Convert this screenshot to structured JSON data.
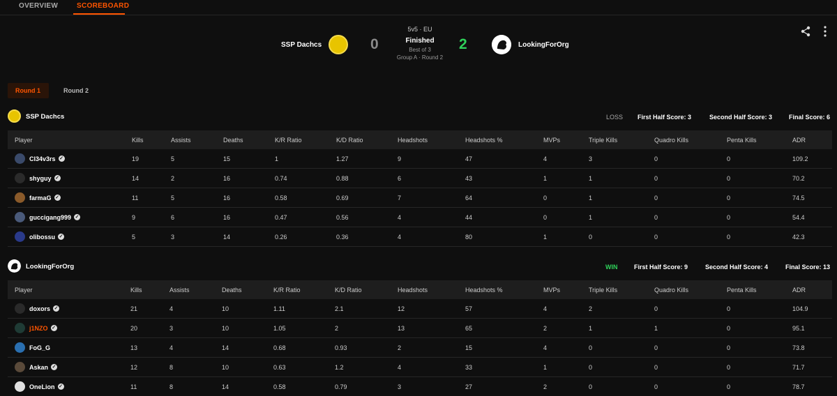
{
  "nav": {
    "tabs": [
      {
        "label": "OVERVIEW"
      },
      {
        "label": "SCOREBOARD"
      }
    ]
  },
  "match": {
    "team1": {
      "name": "SSP Dachcs",
      "score": "0"
    },
    "team2": {
      "name": "LookingForOrg",
      "score": "2"
    },
    "format": "5v5 · EU",
    "status": "Finished",
    "best_of": "Best of 3",
    "stage": "Group A · Round 2"
  },
  "rounds": [
    {
      "label": "Round 1"
    },
    {
      "label": "Round 2"
    }
  ],
  "columns": [
    "Player",
    "Kills",
    "Assists",
    "Deaths",
    "K/R Ratio",
    "K/D Ratio",
    "Headshots",
    "Headshots %",
    "MVPs",
    "Triple Kills",
    "Quadro Kills",
    "Penta Kills",
    "ADR"
  ],
  "teams": [
    {
      "name": "SSP Dachcs",
      "result": "LOSS",
      "first_half": "First Half Score: 3",
      "second_half": "Second Half Score: 3",
      "final": "Final Score: 6",
      "players": [
        {
          "name": "Cl34v3rs",
          "stats": [
            "19",
            "5",
            "15",
            "1",
            "1.27",
            "9",
            "47",
            "4",
            "3",
            "0",
            "0",
            "109.2"
          ]
        },
        {
          "name": "shyguy",
          "stats": [
            "14",
            "2",
            "16",
            "0.74",
            "0.88",
            "6",
            "43",
            "1",
            "1",
            "0",
            "0",
            "70.2"
          ]
        },
        {
          "name": "farmaG",
          "stats": [
            "11",
            "5",
            "16",
            "0.58",
            "0.69",
            "7",
            "64",
            "0",
            "1",
            "0",
            "0",
            "74.5"
          ]
        },
        {
          "name": "guccigang999",
          "stats": [
            "9",
            "6",
            "16",
            "0.47",
            "0.56",
            "4",
            "44",
            "0",
            "1",
            "0",
            "0",
            "54.4"
          ]
        },
        {
          "name": "olibossu",
          "stats": [
            "5",
            "3",
            "14",
            "0.26",
            "0.36",
            "4",
            "80",
            "1",
            "0",
            "0",
            "0",
            "42.3"
          ]
        }
      ]
    },
    {
      "name": "LookingForOrg",
      "result": "WIN",
      "first_half": "First Half Score: 9",
      "second_half": "Second Half Score: 4",
      "final": "Final Score: 13",
      "players": [
        {
          "name": "doxors",
          "stats": [
            "21",
            "4",
            "10",
            "1.11",
            "2.1",
            "12",
            "57",
            "4",
            "2",
            "0",
            "0",
            "104.9"
          ]
        },
        {
          "name": "j1NZO",
          "stats": [
            "20",
            "3",
            "10",
            "1.05",
            "2",
            "13",
            "65",
            "2",
            "1",
            "1",
            "0",
            "95.1"
          ]
        },
        {
          "name": "FoG_G",
          "stats": [
            "13",
            "4",
            "14",
            "0.68",
            "0.93",
            "2",
            "15",
            "4",
            "0",
            "0",
            "0",
            "73.8"
          ]
        },
        {
          "name": "Askan",
          "stats": [
            "12",
            "8",
            "10",
            "0.63",
            "1.2",
            "4",
            "33",
            "1",
            "0",
            "0",
            "0",
            "71.7"
          ]
        },
        {
          "name": "OneLion",
          "stats": [
            "11",
            "8",
            "14",
            "0.58",
            "0.79",
            "3",
            "27",
            "2",
            "0",
            "0",
            "0",
            "78.7"
          ]
        }
      ]
    }
  ],
  "colors": {
    "accent": "#ff5500",
    "win": "#2fd15a",
    "background": "#0f0f0f"
  },
  "icons": [
    "share-icon",
    "more-vertical-icon",
    "verified-icon"
  ]
}
